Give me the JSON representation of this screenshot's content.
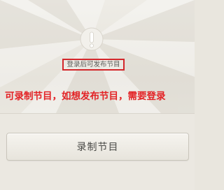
{
  "empty_state": {
    "icon": "exclamation-icon",
    "message": "登录后可发布节目"
  },
  "annotation": {
    "text": "可录制节目，如想发布节目，需要登录"
  },
  "actions": {
    "record_label": "录制节目"
  },
  "colors": {
    "background": "#e9e6de",
    "annotation_red": "#e32225",
    "highlight_border": "#d3272b",
    "icon_fill": "#f2f0eb",
    "button_text": "#4a4a47"
  }
}
